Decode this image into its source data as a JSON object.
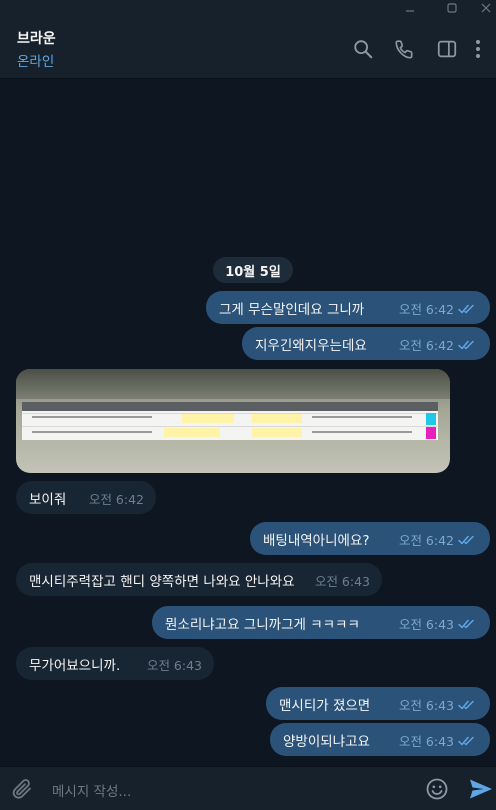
{
  "header": {
    "contact_name": "브라운",
    "status": "온라인",
    "icons": [
      "search-icon",
      "phone-icon",
      "sidebar-toggle-icon",
      "more-menu-icon"
    ]
  },
  "window_controls": [
    "minimize-icon",
    "maximize-icon",
    "close-icon"
  ],
  "chat": {
    "date_separator": "10월 5일",
    "messages": [
      {
        "dir": "out",
        "text": "그게 무슨말인데요 그니까",
        "time": "오전 6:42",
        "read": true
      },
      {
        "dir": "out",
        "text": "지우긴왜지우는데요",
        "time": "오전 6:42",
        "read": true
      },
      {
        "dir": "in",
        "type": "image",
        "description_icon": "screenshot-image"
      },
      {
        "dir": "in",
        "text": "보이줘",
        "time": "오전 6:42"
      },
      {
        "dir": "out",
        "text": "배팅내역아니에요?",
        "time": "오전 6:42",
        "read": true
      },
      {
        "dir": "in",
        "text": "맨시티주력잡고 핸디 양쪽하면 나와요 안나와요",
        "time": "오전 6:43"
      },
      {
        "dir": "out",
        "text": "뭔소리냐고요 그니까그게 ㅋㅋㅋㅋ",
        "time": "오전 6:43",
        "read": true
      },
      {
        "dir": "in",
        "text": "무가어뵤으니까.",
        "time": "오전 6:43"
      },
      {
        "dir": "out",
        "text": "맨시티가 졌으면",
        "time": "오전 6:43",
        "read": true
      },
      {
        "dir": "out",
        "text": "양방이되냐고요",
        "time": "오전 6:43",
        "read": true
      }
    ]
  },
  "composer": {
    "placeholder": "메시지 작성...",
    "icons": [
      "attach-icon",
      "emoji-icon",
      "send-icon"
    ]
  },
  "colors": {
    "background": "#0e1621",
    "header": "#17212b",
    "outgoing_bubble": "#2b5278",
    "incoming_bubble": "#182533",
    "accent": "#5fa6e6"
  }
}
